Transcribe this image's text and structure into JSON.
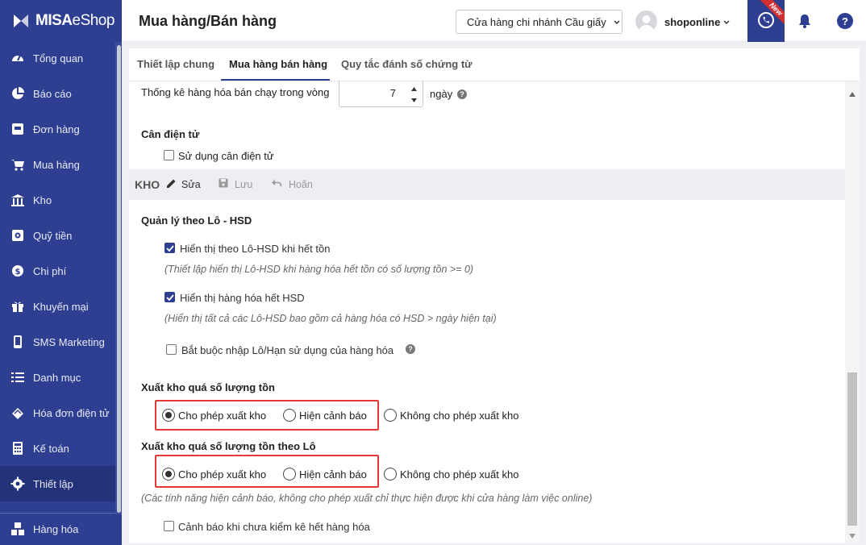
{
  "app": {
    "brand_bold": "MISA",
    "brand_light": "eShop"
  },
  "sidebar": {
    "items": [
      {
        "label": "Tổng quan",
        "icon": "dashboard-icon"
      },
      {
        "label": "Báo cáo",
        "icon": "pie-chart-icon"
      },
      {
        "label": "Đơn hàng",
        "icon": "order-icon"
      },
      {
        "label": "Mua hàng",
        "icon": "cart-icon"
      },
      {
        "label": "Kho",
        "icon": "warehouse-icon"
      },
      {
        "label": "Quỹ tiền",
        "icon": "safe-icon"
      },
      {
        "label": "Chi phí",
        "icon": "money-icon"
      },
      {
        "label": "Khuyến mại",
        "icon": "gift-icon"
      },
      {
        "label": "SMS Marketing",
        "icon": "phone-icon"
      },
      {
        "label": "Danh mục",
        "icon": "list-icon"
      },
      {
        "label": "Hóa đơn điện tử",
        "icon": "invoice-icon"
      },
      {
        "label": "Kế toán",
        "icon": "calculator-icon"
      },
      {
        "label": "Thiết lập",
        "icon": "gear-icon"
      },
      {
        "label": "Hàng hóa",
        "icon": "boxes-icon"
      }
    ]
  },
  "header": {
    "title": "Mua hàng/Bán hàng",
    "branch": "Cửa hàng chi nhánh Cầu giấy",
    "user": "shoponline",
    "new_badge": "New",
    "help": "?"
  },
  "tabs": [
    "Thiết lập chung",
    "Mua hàng bán hàng",
    "Quy tắc đánh số chứng từ"
  ],
  "content": {
    "bestseller_label": "Thống kê hàng hóa bán chạy trong vòng",
    "bestseller_value": "7",
    "bestseller_unit": "ngày",
    "scale_heading": "Cân điện tử",
    "scale_option": "Sử dụng cân điện tử",
    "kho_title": "KHO",
    "kho_edit": "Sửa",
    "kho_save": "Lưu",
    "kho_undo": "Hoãn",
    "lot_heading": "Quản lý theo Lô - HSD",
    "lot_opt1": "Hiển thị theo Lô-HSD khi hết tồn",
    "lot_opt1_note": "(Thiết lập hiển thị Lô-HSD khi hàng hóa hết tồn có số lượng tồn >= 0)",
    "lot_opt2": "Hiển thị hàng hóa hết HSD",
    "lot_opt2_note": "(Hiển thị tất cả các Lô-HSD bao gồm cả hàng hóa có HSD > ngày hiện tại)",
    "lot_opt3": "Bắt buộc nhập Lô/Hạn sử dụng của hàng hóa",
    "over_heading": "Xuất kho quá số lượng tồn",
    "over_lot_heading": "Xuất kho quá số lượng tồn theo Lô",
    "opt_allow": "Cho phép xuất kho",
    "opt_warn": "Hiện cảnh báo",
    "opt_deny": "Không cho phép xuất kho",
    "over_note": "(Các tính năng hiện cảnh báo, không cho phép xuất chỉ thực hiện được khi cửa hàng làm việc online)",
    "stocktake_warn": "Cảnh báo khi chưa kiểm kê hết hàng hóa"
  },
  "colors": {
    "sidebar": "#2e3f92",
    "highlight": "#e53935"
  }
}
